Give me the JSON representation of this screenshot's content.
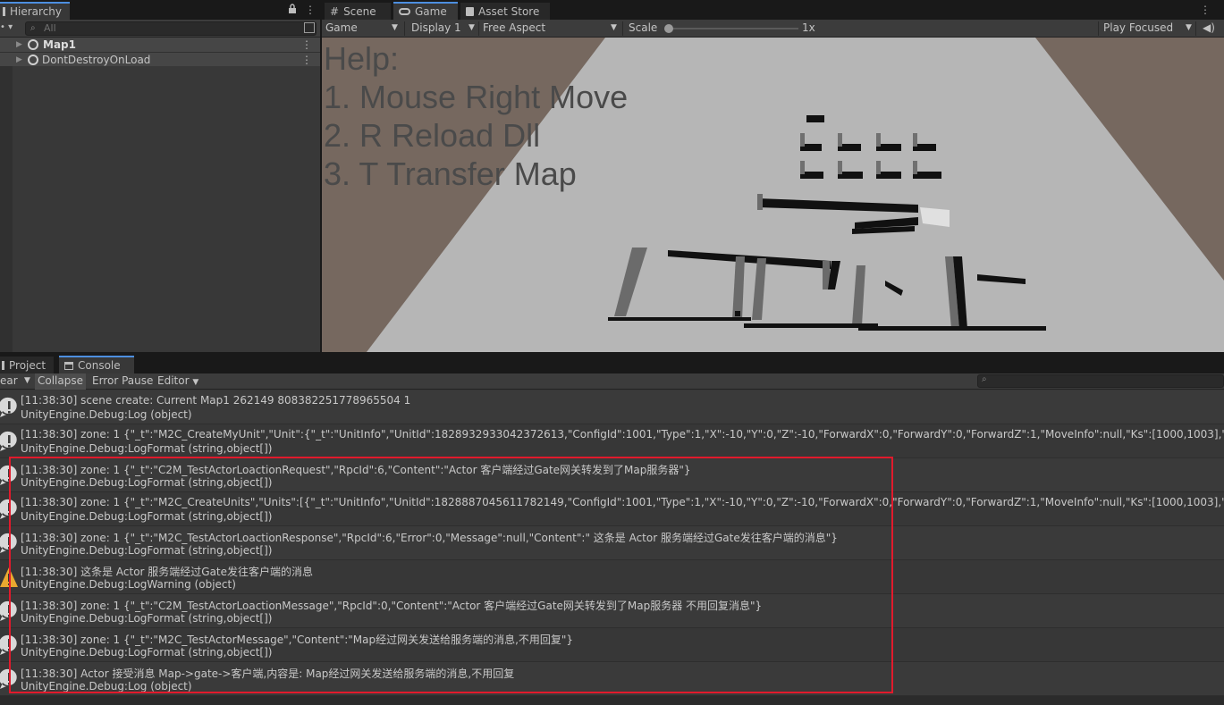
{
  "hierarchy": {
    "tab_label": "Hierarchy",
    "search_placeholder": "All",
    "items": [
      {
        "label": "Map1",
        "icon": "unity-scene-icon"
      },
      {
        "label": "DontDestroyOnLoad",
        "icon": "unity-scene-icon"
      }
    ]
  },
  "game": {
    "tabs": [
      {
        "label": "Scene",
        "icon": "grid-icon"
      },
      {
        "label": "Game",
        "icon": "gamepad-icon"
      },
      {
        "label": "Asset Store",
        "icon": "shopping-bag-icon"
      }
    ],
    "toolbar": {
      "view_mode": "Game",
      "display": "Display 1",
      "aspect": "Free Aspect",
      "scale_label": "Scale",
      "scale_value": "1x",
      "play_mode": "Play Focused"
    },
    "help_lines": [
      "Help:",
      "1. Mouse Right Move",
      "2. R Reload Dll",
      "3. T Transfer Map"
    ],
    "colors": {
      "sky": "#76685f",
      "ground": "#b6b6b6",
      "wall": "#6b6b6b"
    }
  },
  "console": {
    "tabs": [
      {
        "label": "Project",
        "icon": "folder-icon"
      },
      {
        "label": "Console",
        "icon": "console-icon"
      }
    ],
    "toolbar": {
      "clear": "ear",
      "collapse": "Collapse",
      "error_pause": "Error Pause",
      "editor": "Editor"
    },
    "logs": [
      {
        "type": "info",
        "line1": "[11:38:30] scene create: Current Map1 262149 808382251778965504 1",
        "line2": "UnityEngine.Debug:Log (object)"
      },
      {
        "type": "info",
        "line1": "[11:38:30] zone: 1 {\"_t\":\"M2C_CreateMyUnit\",\"Unit\":{\"_t\":\"UnitInfo\",\"UnitId\":1828932933042372613,\"ConfigId\":1001,\"Type\":1,\"X\":-10,\"Y\":0,\"Z\":-10,\"ForwardX\":0,\"ForwardY\":0,\"ForwardZ\":1,\"MoveInfo\":null,\"Ks\":[1000,1003],\"Vs\":[60000,1500",
        "line2": "UnityEngine.Debug:LogFormat (string,object[])"
      },
      {
        "type": "info",
        "line1": "[11:38:30] zone: 1 {\"_t\":\"C2M_TestActorLoactionRequest\",\"RpcId\":6,\"Content\":\"Actor 客户端经过Gate网关转发到了Map服务器\"}",
        "line2": "UnityEngine.Debug:LogFormat (string,object[])"
      },
      {
        "type": "info",
        "line1": "[11:38:30] zone: 1 {\"_t\":\"M2C_CreateUnits\",\"Units\":[{\"_t\":\"UnitInfo\",\"UnitId\":1828887045611782149,\"ConfigId\":1001,\"Type\":1,\"X\":-10,\"Y\":0,\"Z\":-10,\"ForwardX\":0,\"ForwardY\":0,\"ForwardZ\":1,\"MoveInfo\":null,\"Ks\":[1000,1003],\"Vs\":[60000,15000",
        "line2": "UnityEngine.Debug:LogFormat (string,object[])"
      },
      {
        "type": "info",
        "line1": "[11:38:30] zone: 1 {\"_t\":\"M2C_TestActorLoactionResponse\",\"RpcId\":6,\"Error\":0,\"Message\":null,\"Content\":\" 这条是 Actor 服务端经过Gate发往客户端的消息\"}",
        "line2": "UnityEngine.Debug:LogFormat (string,object[])"
      },
      {
        "type": "warning",
        "line1": "[11:38:30]  这条是 Actor 服务端经过Gate发往客户端的消息",
        "line2": "UnityEngine.Debug:LogWarning (object)"
      },
      {
        "type": "info",
        "line1": "[11:38:30] zone: 1 {\"_t\":\"C2M_TestActorLoactionMessage\",\"RpcId\":0,\"Content\":\"Actor 客户端经过Gate网关转发到了Map服务器 不用回复消息\"}",
        "line2": "UnityEngine.Debug:LogFormat (string,object[])"
      },
      {
        "type": "info",
        "line1": "[11:38:30] zone: 1 {\"_t\":\"M2C_TestActorMessage\",\"Content\":\"Map经过网关发送给服务端的消息,不用回复\"}",
        "line2": "UnityEngine.Debug:LogFormat (string,object[])"
      },
      {
        "type": "info",
        "line1": "[11:38:30] Actor 接受消息 Map->gate->客户端,内容是: Map经过网关发送给服务端的消息,不用回复",
        "line2": "UnityEngine.Debug:Log (object)"
      }
    ],
    "highlight_color": "#e11a2c"
  }
}
